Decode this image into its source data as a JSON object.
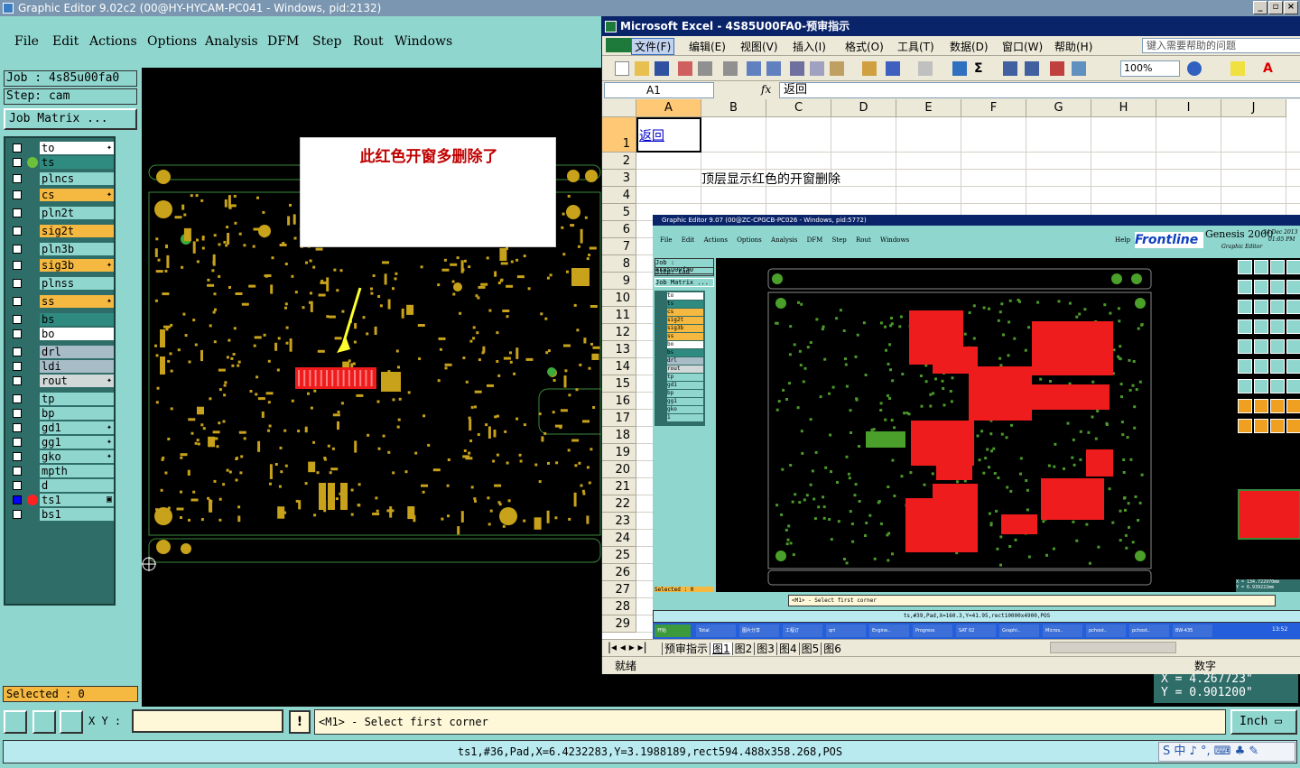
{
  "graphic_editor": {
    "title": "Graphic Editor 9.02c2 (00@HY-HYCAM-PC041 - Windows, pid:2132)",
    "menu": [
      "File",
      "Edit",
      "Actions",
      "Options",
      "Analysis",
      "DFM",
      "Step",
      "Rout",
      "Windows"
    ],
    "job_label": "Job : 4s85u00fa0",
    "step_label": "Step: cam",
    "job_matrix_label": "Job Matrix ...",
    "layers": [
      {
        "name": "to",
        "color": "#ffffff",
        "flag": "✦"
      },
      {
        "name": "ts",
        "color": "#2f8a80",
        "flag": "",
        "dot": "#6bbf3a"
      },
      {
        "name": "plncs",
        "color": "#8fd6cf",
        "flag": ""
      },
      {
        "name": "cs",
        "color": "#f5b840",
        "flag": "✦"
      },
      {
        "name": "pln2t",
        "color": "#8fd6cf",
        "flag": ""
      },
      {
        "name": "sig2t",
        "color": "#f5b840",
        "flag": ""
      },
      {
        "name": "pln3b",
        "color": "#8fd6cf",
        "flag": ""
      },
      {
        "name": "sig3b",
        "color": "#f5b840",
        "flag": "✦"
      },
      {
        "name": "plnss",
        "color": "#8fd6cf",
        "flag": ""
      },
      {
        "name": "ss",
        "color": "#f5b840",
        "flag": "✦"
      },
      {
        "name": "bs",
        "color": "#2f8a80",
        "flag": ""
      },
      {
        "name": "bo",
        "color": "#ffffff",
        "flag": ""
      },
      {
        "name": "drl",
        "color": "#a8bcc8",
        "flag": ""
      },
      {
        "name": "ldi",
        "color": "#a8bcc8",
        "flag": ""
      },
      {
        "name": "rout",
        "color": "#d0d8d8",
        "flag": "✦"
      },
      {
        "name": "tp",
        "color": "#8fd6cf",
        "flag": ""
      },
      {
        "name": "bp",
        "color": "#8fd6cf",
        "flag": ""
      },
      {
        "name": "gd1",
        "color": "#8fd6cf",
        "flag": "✦"
      },
      {
        "name": "gg1",
        "color": "#8fd6cf",
        "flag": "✦"
      },
      {
        "name": "gko",
        "color": "#8fd6cf",
        "flag": "✦"
      },
      {
        "name": "mpth",
        "color": "#8fd6cf",
        "flag": ""
      },
      {
        "name": "d",
        "color": "#8fd6cf",
        "flag": ""
      },
      {
        "name": "ts1",
        "color": "#8fd6cf",
        "flag": "▣",
        "dot": "#ff2020",
        "checked": true
      },
      {
        "name": "bs1",
        "color": "#8fd6cf",
        "flag": ""
      }
    ],
    "selected_label": "Selected : 0",
    "xy_label": "X Y :",
    "prompt": "<M1> - Select first corner",
    "units_button": "Inch",
    "coordinates": {
      "x": "X  = 4.267723\"",
      "y": "Y  = 0.901200\""
    },
    "status_line": "ts1,#36,Pad,X=6.4232283,Y=3.1988189,rect594.488x358.268,POS",
    "annotation": "此红色开窗多删除了",
    "ime_bar": "S 中 ♪ °, ⌨ ♣ ✎"
  },
  "excel": {
    "title": "Microsoft Excel - 4S85U00FA0-预审指示",
    "menu": [
      "文件(F)",
      "编辑(E)",
      "视图(V)",
      "插入(I)",
      "格式(O)",
      "工具(T)",
      "数据(D)",
      "窗口(W)",
      "帮助(H)"
    ],
    "help_placeholder": "键入需要帮助的问题",
    "zoom": "100%",
    "name_box": "A1",
    "fx": "fx",
    "formula": "返回",
    "columns": [
      "A",
      "B",
      "C",
      "D",
      "E",
      "F",
      "G",
      "H",
      "I",
      "J"
    ],
    "rows": [
      "1",
      "2",
      "3",
      "4",
      "5",
      "6",
      "7",
      "8",
      "9",
      "10",
      "11",
      "12",
      "13",
      "14",
      "15",
      "16",
      "17",
      "18",
      "19",
      "20",
      "21",
      "22",
      "23",
      "24",
      "25",
      "26",
      "27",
      "28",
      "29"
    ],
    "cell_a1": "返回",
    "cell_b3": "顶层显示红色的开窗删除",
    "sheet_tabs": [
      "预审指示",
      "图1",
      "图2",
      "图3",
      "图4",
      "图5",
      "图6"
    ],
    "status_left": "就绪",
    "status_right": "数字"
  },
  "embedded_screenshot": {
    "title": "Graphic Editor 9.07 (00@ZC-CPGCB-PC026 - Windows, pid:5772)",
    "menu": [
      "File",
      "Edit",
      "Actions",
      "Options",
      "Analysis",
      "DFM",
      "Step",
      "Rout",
      "Windows",
      "Help"
    ],
    "brand": "Frontline",
    "product": "Genesis 2000",
    "date": "24 Dec 2013",
    "time": "01:05 PM",
    "product_sub": "Graphic Editor",
    "job": "Job : 4s85u00fa0",
    "step": "Step: cad",
    "job_matrix": "Job Matrix ...",
    "layers": [
      "to",
      "ts",
      "cs",
      "sig2t",
      "sig3b",
      "ss",
      "bo",
      "bs",
      "drl",
      "rout",
      "tp",
      "gd1",
      "bp",
      "gg1",
      "gko",
      "1"
    ],
    "selected": "Selected : 0",
    "prompt": "<M1> - Select first corner",
    "status": "ts,#39,Pad,X=160.3,Y=41.95,rect10000x4900,POS",
    "coords": "X = 134.722970mm\nY = 6.939222mm",
    "taskbar": [
      "开始",
      "Total",
      "图片分享",
      "工程订",
      "qrt",
      "Engine..",
      "Progress",
      "SAT 02",
      "Graphi..",
      "Micros..",
      "pchost..",
      "pchost..",
      "BW-435"
    ],
    "clock": "13:52"
  }
}
